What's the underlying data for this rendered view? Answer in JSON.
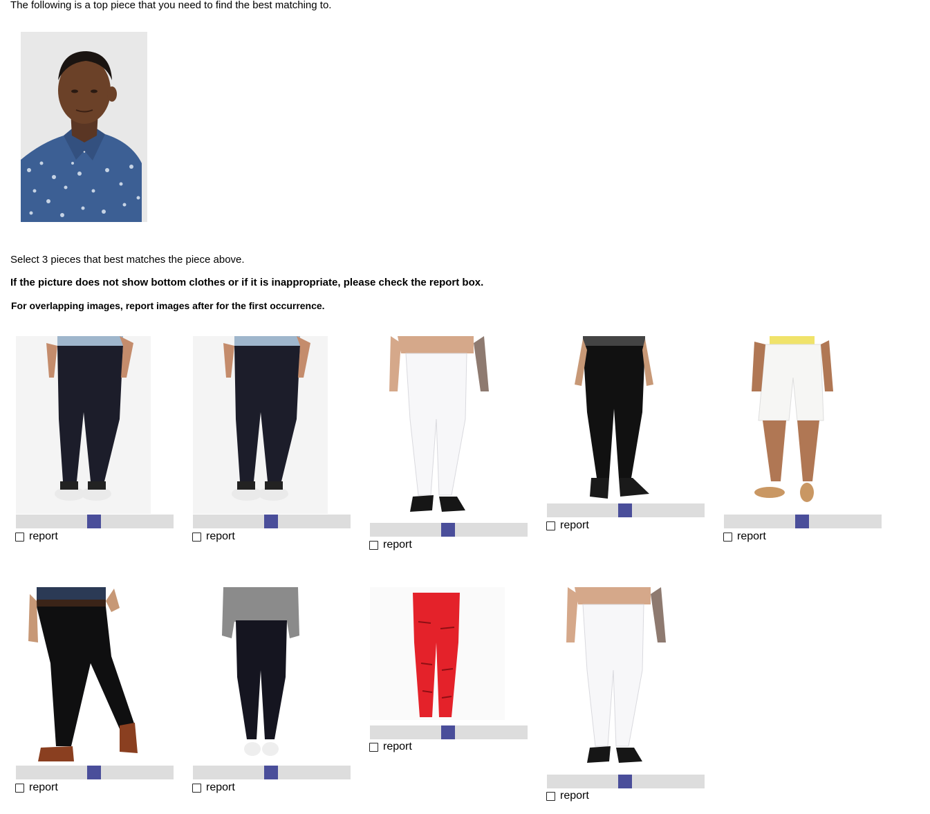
{
  "instructions": {
    "intro": "The following is a top piece that you need to find the best matching to.",
    "select": "Select 3 pieces that best matches the piece above.",
    "report_rule": "If the picture does not show bottom clothes or if it is inappropriate, please check the report box.",
    "overlap_rule": "For overlapping images, report images after for the first occurrence."
  },
  "top_piece": {
    "icon": "man-in-blue-floral-shirt-photo"
  },
  "items": [
    {
      "icon": "dark-navy-jeans-photo",
      "slider_value": 0.5,
      "report_label": "report",
      "report_checked": false
    },
    {
      "icon": "dark-navy-jeans-photo",
      "slider_value": 0.5,
      "report_label": "report",
      "report_checked": false
    },
    {
      "icon": "white-jeans-photo",
      "slider_value": 0.5,
      "report_label": "report",
      "report_checked": false
    },
    {
      "icon": "black-jeans-photo",
      "slider_value": 0.5,
      "report_label": "report",
      "report_checked": false
    },
    {
      "icon": "white-shorts-photo",
      "slider_value": 0.5,
      "report_label": "report",
      "report_checked": false
    },
    {
      "icon": "black-chinos-photo",
      "slider_value": 0.5,
      "report_label": "report",
      "report_checked": false
    },
    {
      "icon": "black-skinny-jeans-photo",
      "slider_value": 0.5,
      "report_label": "report",
      "report_checked": false
    },
    {
      "icon": "red-ripped-jeans-photo",
      "slider_value": 0.5,
      "report_label": "report",
      "report_checked": false
    },
    {
      "icon": "white-jeans-photo",
      "slider_value": 0.5,
      "report_label": "report",
      "report_checked": false
    }
  ]
}
